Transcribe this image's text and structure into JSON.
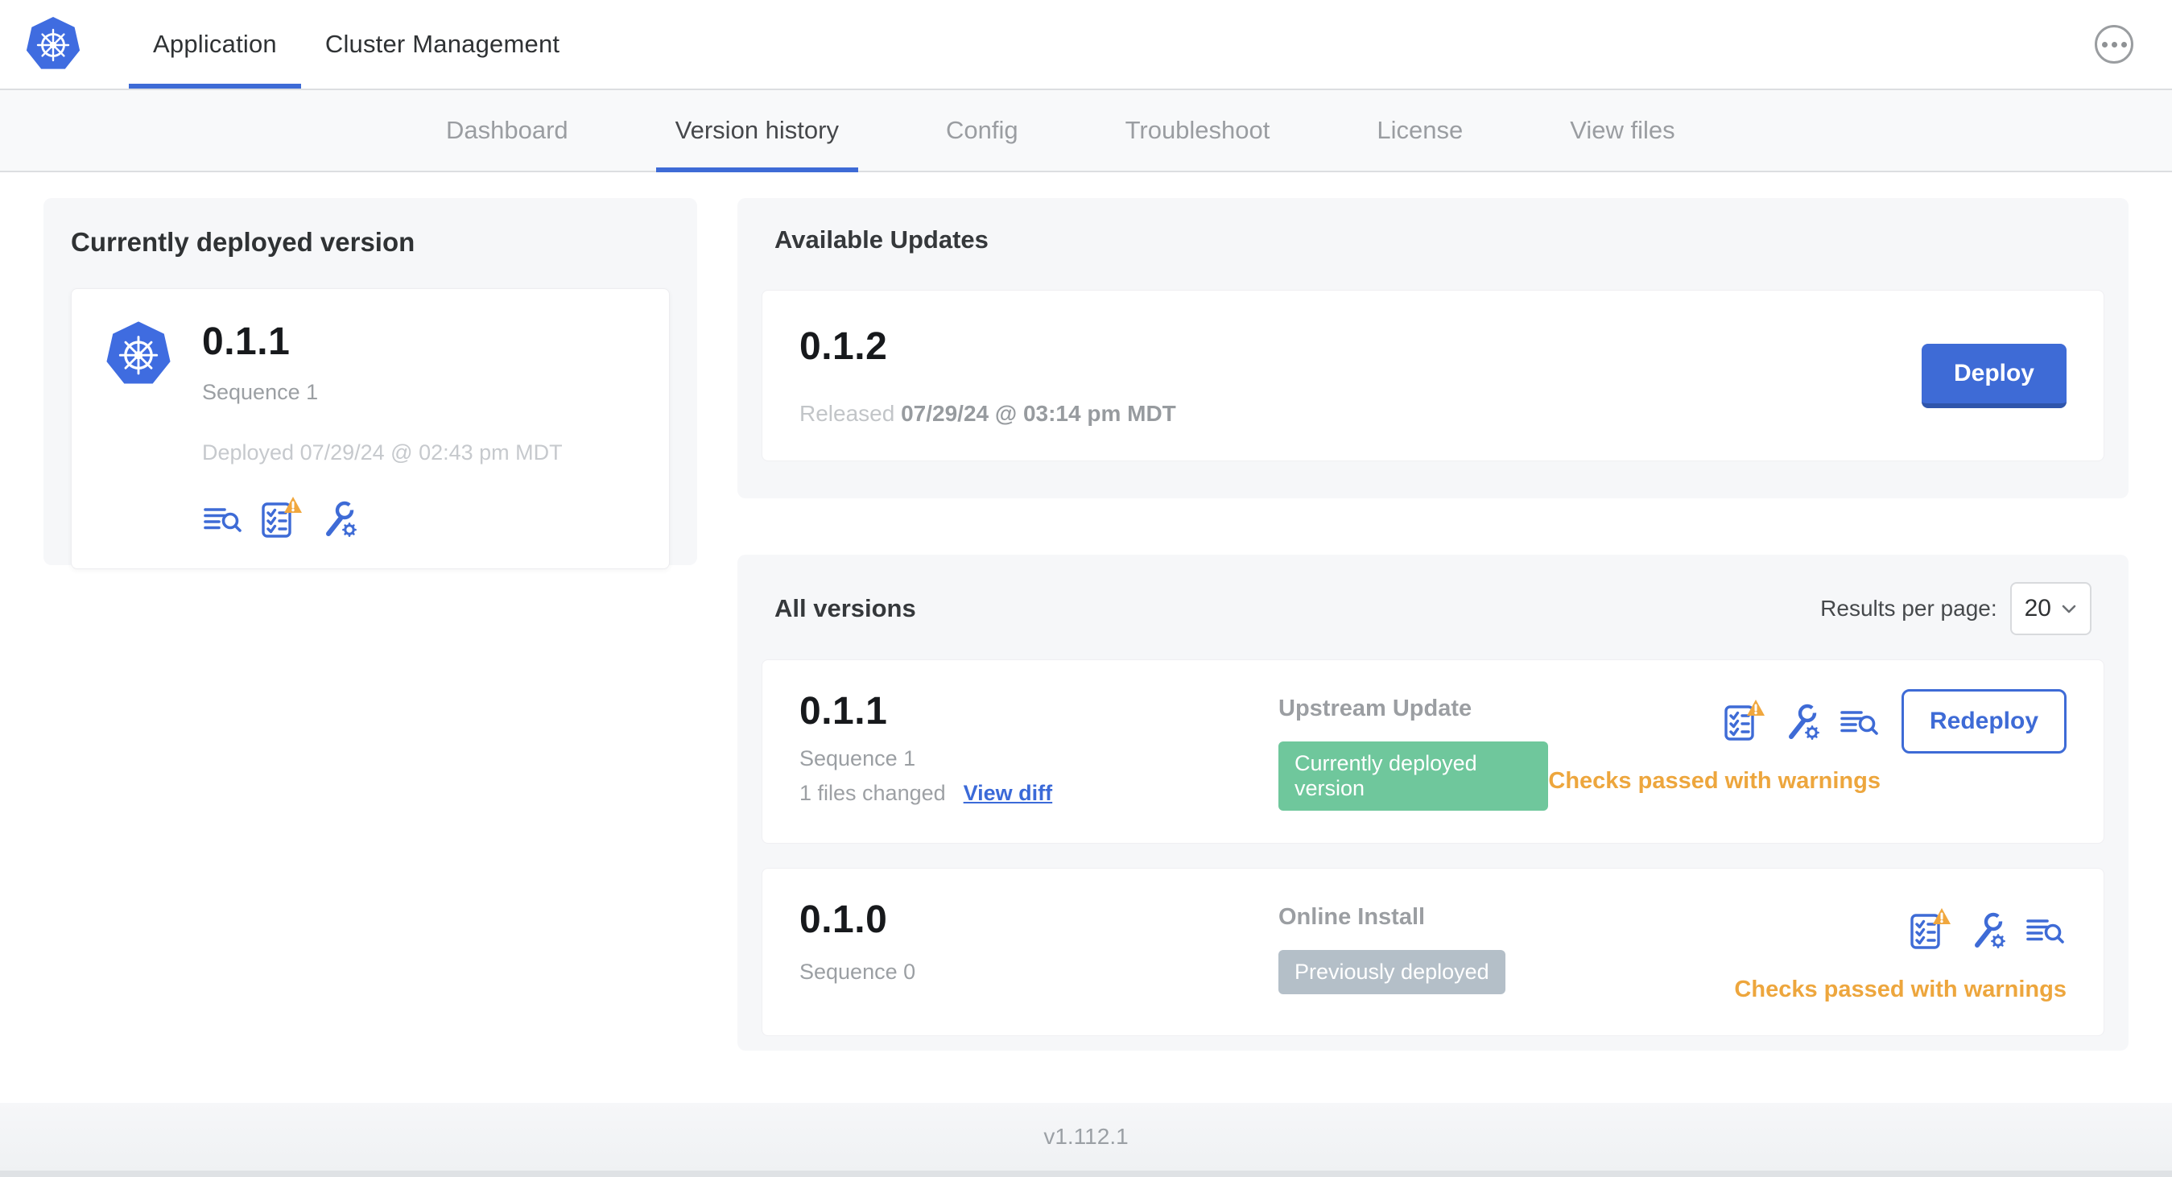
{
  "header": {
    "logo_icon": "kubernetes-logo",
    "tabs": [
      {
        "label": "Application",
        "active": true
      },
      {
        "label": "Cluster Management",
        "active": false
      }
    ],
    "menu_icon": "ellipsis-icon"
  },
  "subnav": {
    "tabs": [
      "Dashboard",
      "Version history",
      "Config",
      "Troubleshoot",
      "License",
      "View files"
    ],
    "active": "Version history"
  },
  "currently_deployed": {
    "title": "Currently deployed version",
    "version": "0.1.1",
    "sequence": "Sequence 1",
    "deployed": "Deployed 07/29/24 @ 02:43 pm MDT",
    "icons": [
      "logs-icon",
      "preflight-checks-warning-icon",
      "config-icon"
    ]
  },
  "available_updates": {
    "title": "Available Updates",
    "version": "0.1.2",
    "released_label": "Released",
    "released_date": "07/29/24 @ 03:14 pm MDT",
    "deploy_button": "Deploy"
  },
  "all_versions": {
    "title": "All versions",
    "results_per_page_label": "Results per page:",
    "results_per_page_value": "20",
    "rows": [
      {
        "version": "0.1.1",
        "sequence": "Sequence 1",
        "files_changed": "1 files changed",
        "view_diff_link": "View diff",
        "source": "Upstream Update",
        "status_badge": "Currently deployed version",
        "badge_style": "green",
        "icons": [
          "preflight-checks-warning-icon",
          "config-icon",
          "logs-icon"
        ],
        "checks_text": "Checks passed with warnings",
        "action_button": "Redeploy"
      },
      {
        "version": "0.1.0",
        "sequence": "Sequence 0",
        "source": "Online Install",
        "status_badge": "Previously deployed",
        "badge_style": "gray",
        "icons": [
          "preflight-checks-warning-icon",
          "config-icon",
          "logs-icon"
        ],
        "checks_text": "Checks passed with warnings"
      }
    ]
  },
  "footer": {
    "app_version": "v1.112.1"
  },
  "colors": {
    "accent_blue": "#3e6bd6",
    "logo_blue": "#3f6ce0",
    "badge_green": "#6fc79c",
    "badge_gray": "#b4bfc8",
    "warning_amber": "#eda63d",
    "text_dark": "#2f3234",
    "text_gray": "#9b9fa3",
    "text_light_gray": "#c6c9cd",
    "subnav_bg": "#f8f9fa",
    "card_bg": "#f6f7f9"
  }
}
